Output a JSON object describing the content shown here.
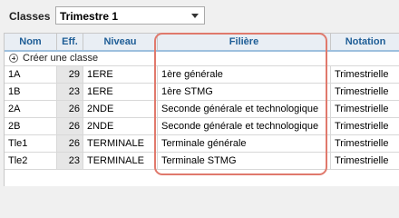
{
  "toolbar": {
    "label": "Classes",
    "period_select": {
      "value": "Trimestre 1",
      "icon": "chevron-down-icon"
    }
  },
  "table": {
    "columns": [
      {
        "key": "nom",
        "label": "Nom"
      },
      {
        "key": "eff",
        "label": "Eff."
      },
      {
        "key": "niveau",
        "label": "Niveau"
      },
      {
        "key": "filiere",
        "label": "Filière"
      },
      {
        "key": "notation",
        "label": "Notation"
      }
    ],
    "create_label": "Créer une classe",
    "create_icon": "plus-circle-icon",
    "rows": [
      {
        "nom": "1A",
        "eff": "29",
        "niveau": "1ERE",
        "filiere": "1ère générale",
        "notation": "Trimestrielle"
      },
      {
        "nom": "1B",
        "eff": "23",
        "niveau": "1ERE",
        "filiere": "1ère STMG",
        "notation": "Trimestrielle"
      },
      {
        "nom": "2A",
        "eff": "26",
        "niveau": "2NDE",
        "filiere": "Seconde générale et technologique",
        "notation": "Trimestrielle"
      },
      {
        "nom": "2B",
        "eff": "26",
        "niveau": "2NDE",
        "filiere": "Seconde générale et technologique",
        "notation": "Trimestrielle"
      },
      {
        "nom": "Tle1",
        "eff": "26",
        "niveau": "TERMINALE",
        "filiere": "Terminale générale",
        "notation": "Trimestrielle"
      },
      {
        "nom": "Tle2",
        "eff": "23",
        "niveau": "TERMINALE",
        "filiere": "Terminale STMG",
        "notation": "Trimestrielle"
      }
    ]
  },
  "colors": {
    "header_text": "#1e5d96",
    "highlight": "#e0796c"
  }
}
